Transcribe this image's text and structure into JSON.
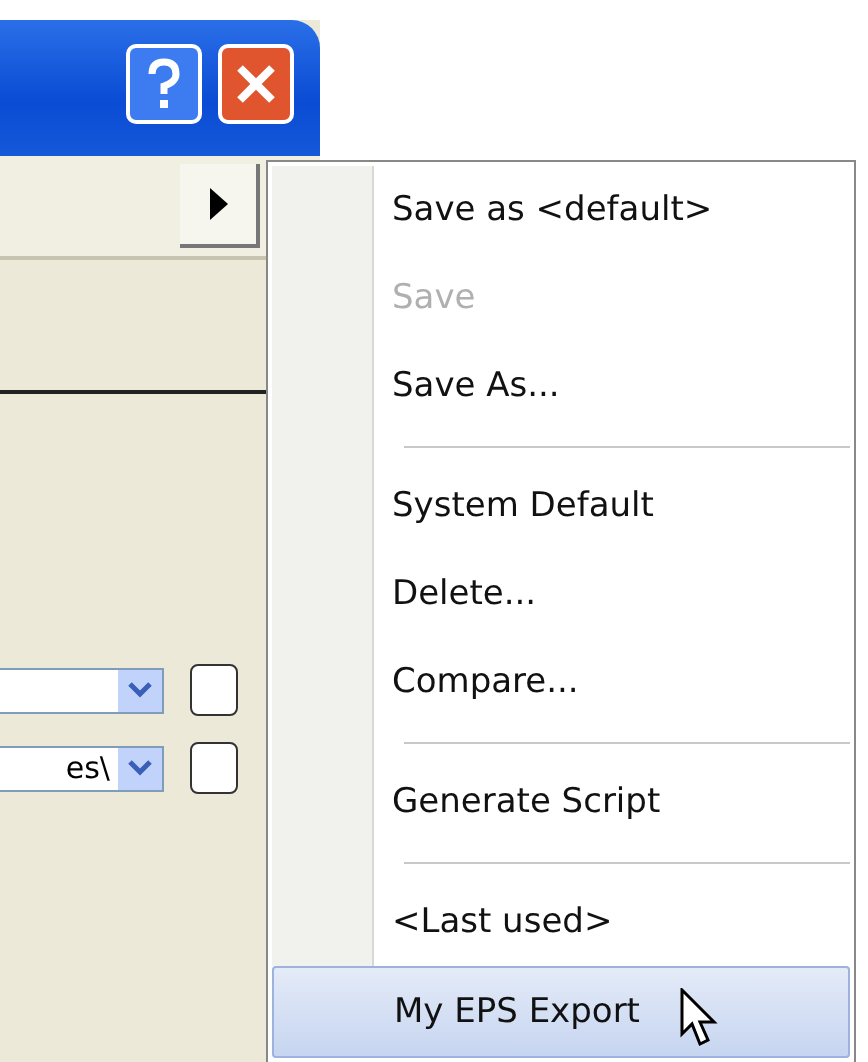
{
  "dialog": {
    "combos": [
      {
        "kind": "blank"
      },
      {
        "kind": "text",
        "value": "es\\"
      }
    ]
  },
  "menu": {
    "items": [
      {
        "kind": "item",
        "label": "Save as <default>",
        "disabled": false,
        "selected": false
      },
      {
        "kind": "item",
        "label": "Save",
        "disabled": true,
        "selected": false
      },
      {
        "kind": "item",
        "label": "Save As...",
        "disabled": false,
        "selected": false
      },
      {
        "kind": "separator"
      },
      {
        "kind": "item",
        "label": "System Default",
        "disabled": false,
        "selected": false
      },
      {
        "kind": "item",
        "label": "Delete...",
        "disabled": false,
        "selected": false
      },
      {
        "kind": "item",
        "label": "Compare...",
        "disabled": false,
        "selected": false
      },
      {
        "kind": "separator"
      },
      {
        "kind": "item",
        "label": "Generate Script",
        "disabled": false,
        "selected": false
      },
      {
        "kind": "separator"
      },
      {
        "kind": "item",
        "label": "<Last used>",
        "disabled": false,
        "selected": false
      },
      {
        "kind": "item",
        "label": "My EPS Export",
        "disabled": false,
        "selected": true
      }
    ]
  }
}
